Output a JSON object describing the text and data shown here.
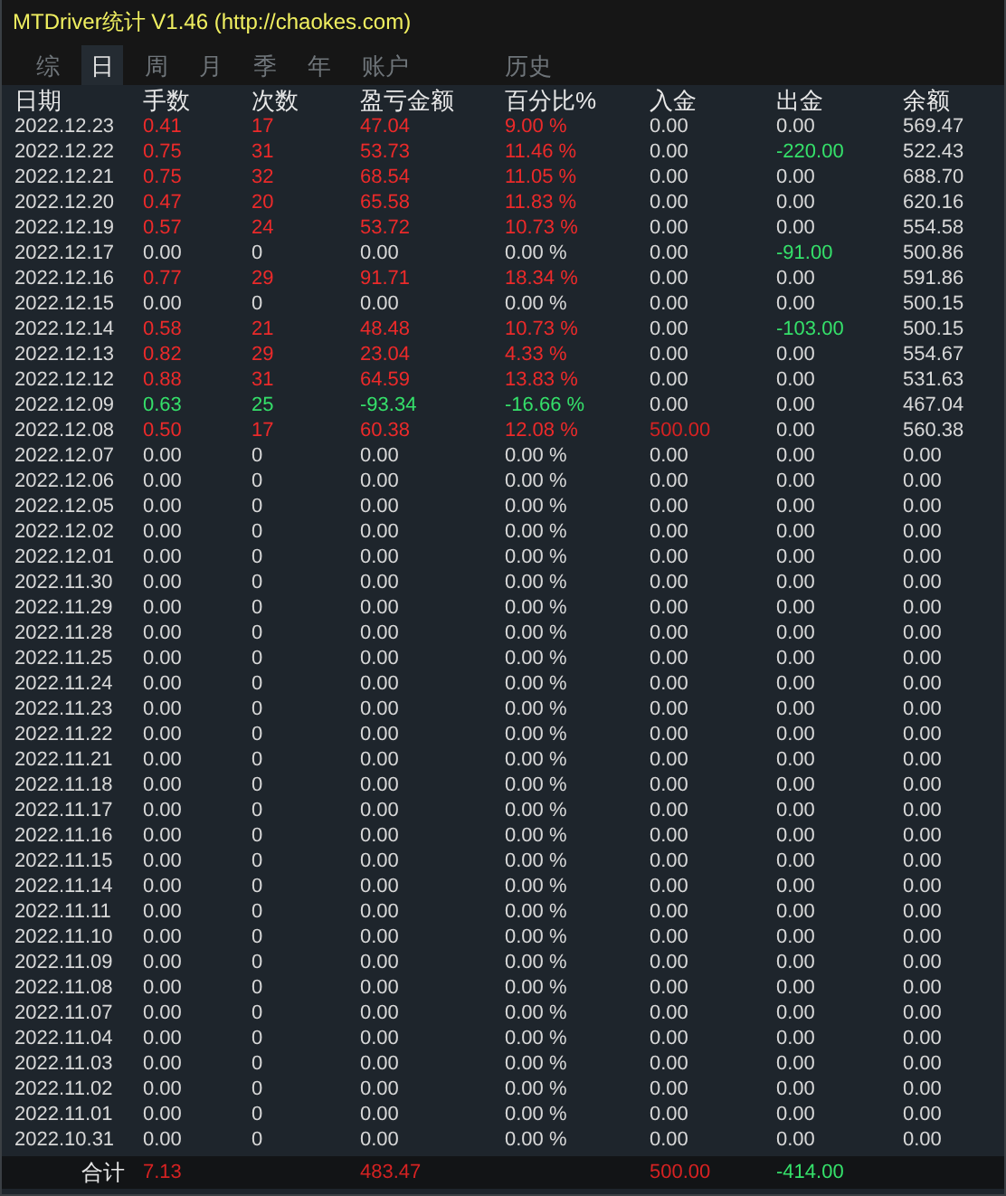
{
  "window": {
    "title": "MTDriver统计 V1.46  (http://chaokes.com)"
  },
  "tabs": [
    {
      "label": "综",
      "selected": false
    },
    {
      "label": "日",
      "selected": true
    },
    {
      "label": "周",
      "selected": false
    },
    {
      "label": "月",
      "selected": false
    },
    {
      "label": "季",
      "selected": false
    },
    {
      "label": "年",
      "selected": false
    },
    {
      "label": "账户",
      "selected": false
    },
    {
      "label": "历史",
      "selected": false
    }
  ],
  "table": {
    "columns": [
      "日期",
      "手数",
      "次数",
      "盈亏金额",
      "百分比%",
      "入金",
      "出金",
      "余额"
    ],
    "rows": [
      {
        "date": "2022.12.23",
        "lots": "0.41",
        "trades": "17",
        "pnl": "47.04",
        "pct": "9.00 %",
        "deposit": "0.00",
        "withdrawal": "0.00",
        "balance": "569.47",
        "color": "#ec2a2a"
      },
      {
        "date": "2022.12.22",
        "lots": "0.75",
        "trades": "31",
        "pnl": "53.73",
        "pct": "11.46 %",
        "deposit": "0.00",
        "withdrawal": {
          "text": "-220.00",
          "color": "#35e06a"
        },
        "balance": "522.43",
        "color": "#ec2a2a"
      },
      {
        "date": "2022.12.21",
        "lots": "0.75",
        "trades": "32",
        "pnl": "68.54",
        "pct": "11.05 %",
        "deposit": "0.00",
        "withdrawal": "0.00",
        "balance": "688.70",
        "color": "#ec2a2a"
      },
      {
        "date": "2022.12.20",
        "lots": "0.47",
        "trades": "20",
        "pnl": "65.58",
        "pct": "11.83 %",
        "deposit": "0.00",
        "withdrawal": "0.00",
        "balance": "620.16",
        "color": "#ec2a2a"
      },
      {
        "date": "2022.12.19",
        "lots": "0.57",
        "trades": "24",
        "pnl": "53.72",
        "pct": "10.73 %",
        "deposit": "0.00",
        "withdrawal": "0.00",
        "balance": "554.58",
        "color": "#ec2a2a"
      },
      {
        "date": "2022.12.17",
        "lots": "0.00",
        "trades": "0",
        "pnl": "0.00",
        "pct": "0.00 %",
        "deposit": "0.00",
        "withdrawal": {
          "text": "-91.00",
          "color": "#35e06a"
        },
        "balance": "500.86",
        "color": "#d8d8d8"
      },
      {
        "date": "2022.12.16",
        "lots": "0.77",
        "trades": "29",
        "pnl": "91.71",
        "pct": "18.34 %",
        "deposit": "0.00",
        "withdrawal": "0.00",
        "balance": "591.86",
        "color": "#ec2a2a"
      },
      {
        "date": "2022.12.15",
        "lots": "0.00",
        "trades": "0",
        "pnl": "0.00",
        "pct": "0.00 %",
        "deposit": "0.00",
        "withdrawal": "0.00",
        "balance": "500.15",
        "color": "#d8d8d8"
      },
      {
        "date": "2022.12.14",
        "lots": "0.58",
        "trades": "21",
        "pnl": "48.48",
        "pct": "10.73 %",
        "deposit": "0.00",
        "withdrawal": {
          "text": "-103.00",
          "color": "#35e06a"
        },
        "balance": "500.15",
        "color": "#ec2a2a"
      },
      {
        "date": "2022.12.13",
        "lots": "0.82",
        "trades": "29",
        "pnl": "23.04",
        "pct": "4.33 %",
        "deposit": "0.00",
        "withdrawal": "0.00",
        "balance": "554.67",
        "color": "#ec2a2a"
      },
      {
        "date": "2022.12.12",
        "lots": "0.88",
        "trades": "31",
        "pnl": "64.59",
        "pct": "13.83 %",
        "deposit": "0.00",
        "withdrawal": "0.00",
        "balance": "531.63",
        "color": "#ec2a2a"
      },
      {
        "date": "2022.12.09",
        "lots": "0.63",
        "trades": "25",
        "pnl": "-93.34",
        "pct": "-16.66 %",
        "deposit": "0.00",
        "withdrawal": "0.00",
        "balance": "467.04",
        "color": "#35e06a"
      },
      {
        "date": "2022.12.08",
        "lots": "0.50",
        "trades": "17",
        "pnl": "60.38",
        "pct": "12.08 %",
        "deposit": {
          "text": "500.00",
          "color": "#d62222"
        },
        "withdrawal": "0.00",
        "balance": "560.38",
        "color": "#ec2a2a"
      },
      {
        "date": "2022.12.07",
        "lots": "0.00",
        "trades": "0",
        "pnl": "0.00",
        "pct": "0.00 %",
        "deposit": "0.00",
        "withdrawal": "0.00",
        "balance": "0.00",
        "color": "#d8d8d8"
      },
      {
        "date": "2022.12.06",
        "lots": "0.00",
        "trades": "0",
        "pnl": "0.00",
        "pct": "0.00 %",
        "deposit": "0.00",
        "withdrawal": "0.00",
        "balance": "0.00",
        "color": "#d8d8d8"
      },
      {
        "date": "2022.12.05",
        "lots": "0.00",
        "trades": "0",
        "pnl": "0.00",
        "pct": "0.00 %",
        "deposit": "0.00",
        "withdrawal": "0.00",
        "balance": "0.00",
        "color": "#d8d8d8"
      },
      {
        "date": "2022.12.02",
        "lots": "0.00",
        "trades": "0",
        "pnl": "0.00",
        "pct": "0.00 %",
        "deposit": "0.00",
        "withdrawal": "0.00",
        "balance": "0.00",
        "color": "#d8d8d8"
      },
      {
        "date": "2022.12.01",
        "lots": "0.00",
        "trades": "0",
        "pnl": "0.00",
        "pct": "0.00 %",
        "deposit": "0.00",
        "withdrawal": "0.00",
        "balance": "0.00",
        "color": "#d8d8d8"
      },
      {
        "date": "2022.11.30",
        "lots": "0.00",
        "trades": "0",
        "pnl": "0.00",
        "pct": "0.00 %",
        "deposit": "0.00",
        "withdrawal": "0.00",
        "balance": "0.00",
        "color": "#d8d8d8"
      },
      {
        "date": "2022.11.29",
        "lots": "0.00",
        "trades": "0",
        "pnl": "0.00",
        "pct": "0.00 %",
        "deposit": "0.00",
        "withdrawal": "0.00",
        "balance": "0.00",
        "color": "#d8d8d8"
      },
      {
        "date": "2022.11.28",
        "lots": "0.00",
        "trades": "0",
        "pnl": "0.00",
        "pct": "0.00 %",
        "deposit": "0.00",
        "withdrawal": "0.00",
        "balance": "0.00",
        "color": "#d8d8d8"
      },
      {
        "date": "2022.11.25",
        "lots": "0.00",
        "trades": "0",
        "pnl": "0.00",
        "pct": "0.00 %",
        "deposit": "0.00",
        "withdrawal": "0.00",
        "balance": "0.00",
        "color": "#d8d8d8"
      },
      {
        "date": "2022.11.24",
        "lots": "0.00",
        "trades": "0",
        "pnl": "0.00",
        "pct": "0.00 %",
        "deposit": "0.00",
        "withdrawal": "0.00",
        "balance": "0.00",
        "color": "#d8d8d8"
      },
      {
        "date": "2022.11.23",
        "lots": "0.00",
        "trades": "0",
        "pnl": "0.00",
        "pct": "0.00 %",
        "deposit": "0.00",
        "withdrawal": "0.00",
        "balance": "0.00",
        "color": "#d8d8d8"
      },
      {
        "date": "2022.11.22",
        "lots": "0.00",
        "trades": "0",
        "pnl": "0.00",
        "pct": "0.00 %",
        "deposit": "0.00",
        "withdrawal": "0.00",
        "balance": "0.00",
        "color": "#d8d8d8"
      },
      {
        "date": "2022.11.21",
        "lots": "0.00",
        "trades": "0",
        "pnl": "0.00",
        "pct": "0.00 %",
        "deposit": "0.00",
        "withdrawal": "0.00",
        "balance": "0.00",
        "color": "#d8d8d8"
      },
      {
        "date": "2022.11.18",
        "lots": "0.00",
        "trades": "0",
        "pnl": "0.00",
        "pct": "0.00 %",
        "deposit": "0.00",
        "withdrawal": "0.00",
        "balance": "0.00",
        "color": "#d8d8d8"
      },
      {
        "date": "2022.11.17",
        "lots": "0.00",
        "trades": "0",
        "pnl": "0.00",
        "pct": "0.00 %",
        "deposit": "0.00",
        "withdrawal": "0.00",
        "balance": "0.00",
        "color": "#d8d8d8"
      },
      {
        "date": "2022.11.16",
        "lots": "0.00",
        "trades": "0",
        "pnl": "0.00",
        "pct": "0.00 %",
        "deposit": "0.00",
        "withdrawal": "0.00",
        "balance": "0.00",
        "color": "#d8d8d8"
      },
      {
        "date": "2022.11.15",
        "lots": "0.00",
        "trades": "0",
        "pnl": "0.00",
        "pct": "0.00 %",
        "deposit": "0.00",
        "withdrawal": "0.00",
        "balance": "0.00",
        "color": "#d8d8d8"
      },
      {
        "date": "2022.11.14",
        "lots": "0.00",
        "trades": "0",
        "pnl": "0.00",
        "pct": "0.00 %",
        "deposit": "0.00",
        "withdrawal": "0.00",
        "balance": "0.00",
        "color": "#d8d8d8"
      },
      {
        "date": "2022.11.11",
        "lots": "0.00",
        "trades": "0",
        "pnl": "0.00",
        "pct": "0.00 %",
        "deposit": "0.00",
        "withdrawal": "0.00",
        "balance": "0.00",
        "color": "#d8d8d8"
      },
      {
        "date": "2022.11.10",
        "lots": "0.00",
        "trades": "0",
        "pnl": "0.00",
        "pct": "0.00 %",
        "deposit": "0.00",
        "withdrawal": "0.00",
        "balance": "0.00",
        "color": "#d8d8d8"
      },
      {
        "date": "2022.11.09",
        "lots": "0.00",
        "trades": "0",
        "pnl": "0.00",
        "pct": "0.00 %",
        "deposit": "0.00",
        "withdrawal": "0.00",
        "balance": "0.00",
        "color": "#d8d8d8"
      },
      {
        "date": "2022.11.08",
        "lots": "0.00",
        "trades": "0",
        "pnl": "0.00",
        "pct": "0.00 %",
        "deposit": "0.00",
        "withdrawal": "0.00",
        "balance": "0.00",
        "color": "#d8d8d8"
      },
      {
        "date": "2022.11.07",
        "lots": "0.00",
        "trades": "0",
        "pnl": "0.00",
        "pct": "0.00 %",
        "deposit": "0.00",
        "withdrawal": "0.00",
        "balance": "0.00",
        "color": "#d8d8d8"
      },
      {
        "date": "2022.11.04",
        "lots": "0.00",
        "trades": "0",
        "pnl": "0.00",
        "pct": "0.00 %",
        "deposit": "0.00",
        "withdrawal": "0.00",
        "balance": "0.00",
        "color": "#d8d8d8"
      },
      {
        "date": "2022.11.03",
        "lots": "0.00",
        "trades": "0",
        "pnl": "0.00",
        "pct": "0.00 %",
        "deposit": "0.00",
        "withdrawal": "0.00",
        "balance": "0.00",
        "color": "#d8d8d8"
      },
      {
        "date": "2022.11.02",
        "lots": "0.00",
        "trades": "0",
        "pnl": "0.00",
        "pct": "0.00 %",
        "deposit": "0.00",
        "withdrawal": "0.00",
        "balance": "0.00",
        "color": "#d8d8d8"
      },
      {
        "date": "2022.11.01",
        "lots": "0.00",
        "trades": "0",
        "pnl": "0.00",
        "pct": "0.00 %",
        "deposit": "0.00",
        "withdrawal": "0.00",
        "balance": "0.00",
        "color": "#d8d8d8"
      },
      {
        "date": "2022.10.31",
        "lots": "0.00",
        "trades": "0",
        "pnl": "0.00",
        "pct": "0.00 %",
        "deposit": "0.00",
        "withdrawal": "0.00",
        "balance": "0.00",
        "color": "#d8d8d8"
      }
    ]
  },
  "totals": {
    "label": "合计",
    "lots": "7.13",
    "pnl": "483.47",
    "deposit": "500.00",
    "withdrawal": "-414.00"
  }
}
